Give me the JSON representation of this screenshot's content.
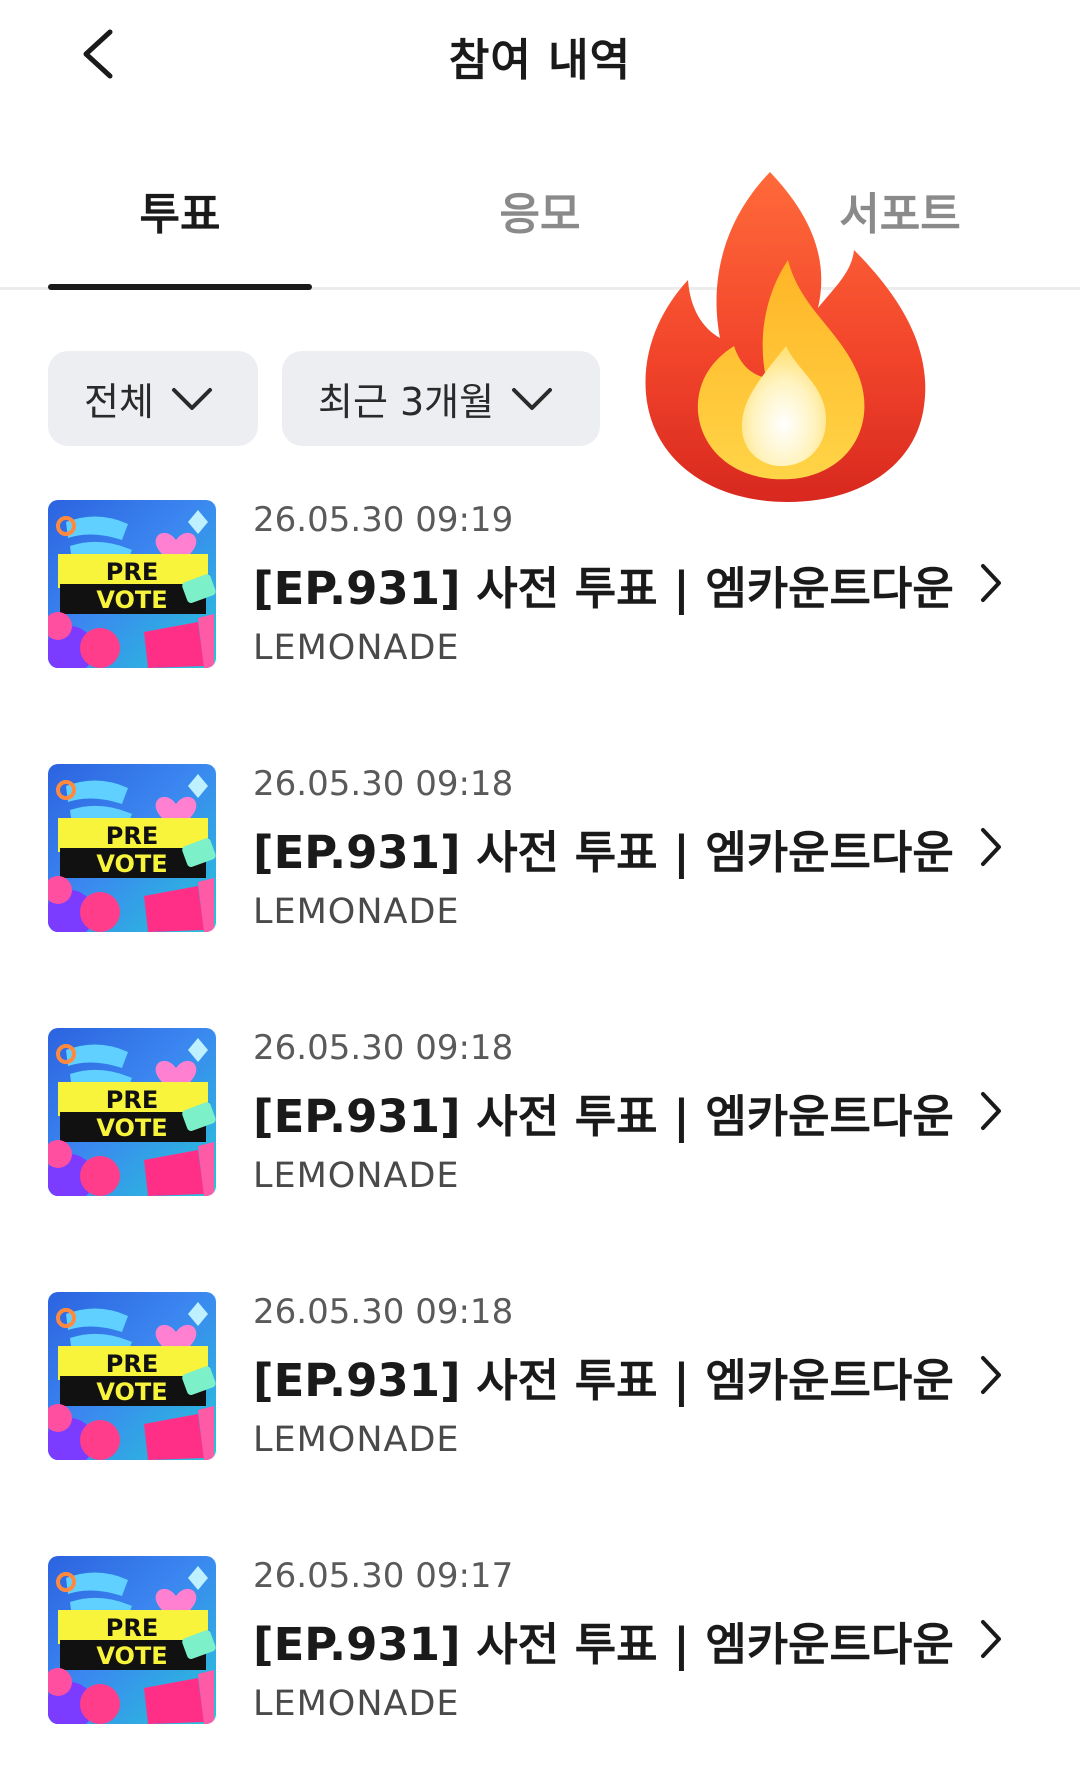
{
  "header": {
    "title": "참여 내역"
  },
  "tabs": [
    {
      "label": "투표",
      "active": true
    },
    {
      "label": "응모",
      "active": false
    },
    {
      "label": "서포트",
      "active": false
    }
  ],
  "filters": {
    "category": "전체",
    "period": "최근 3개월"
  },
  "thumbnail": {
    "line1": "PRE",
    "line2": "VOTE"
  },
  "items": [
    {
      "date": "26.05.30 09:19",
      "title": "[EP.931] 사전 투표 | 엠카운트다운",
      "org": "LEMONADE"
    },
    {
      "date": "26.05.30 09:18",
      "title": "[EP.931] 사전 투표 | 엠카운트다운",
      "org": "LEMONADE"
    },
    {
      "date": "26.05.30 09:18",
      "title": "[EP.931] 사전 투표 | 엠카운트다운",
      "org": "LEMONADE"
    },
    {
      "date": "26.05.30 09:18",
      "title": "[EP.931] 사전 투표 | 엠카운트다운",
      "org": "LEMONADE"
    },
    {
      "date": "26.05.30 09:17",
      "title": "[EP.931] 사전 투표 | 엠카운트다운",
      "org": "LEMONADE"
    }
  ],
  "overlay": {
    "icon": "fire-emoji-icon"
  },
  "colors": {
    "chip_bg": "#eceef2",
    "text": "#1a1a1a",
    "muted": "#8a8a8a"
  }
}
